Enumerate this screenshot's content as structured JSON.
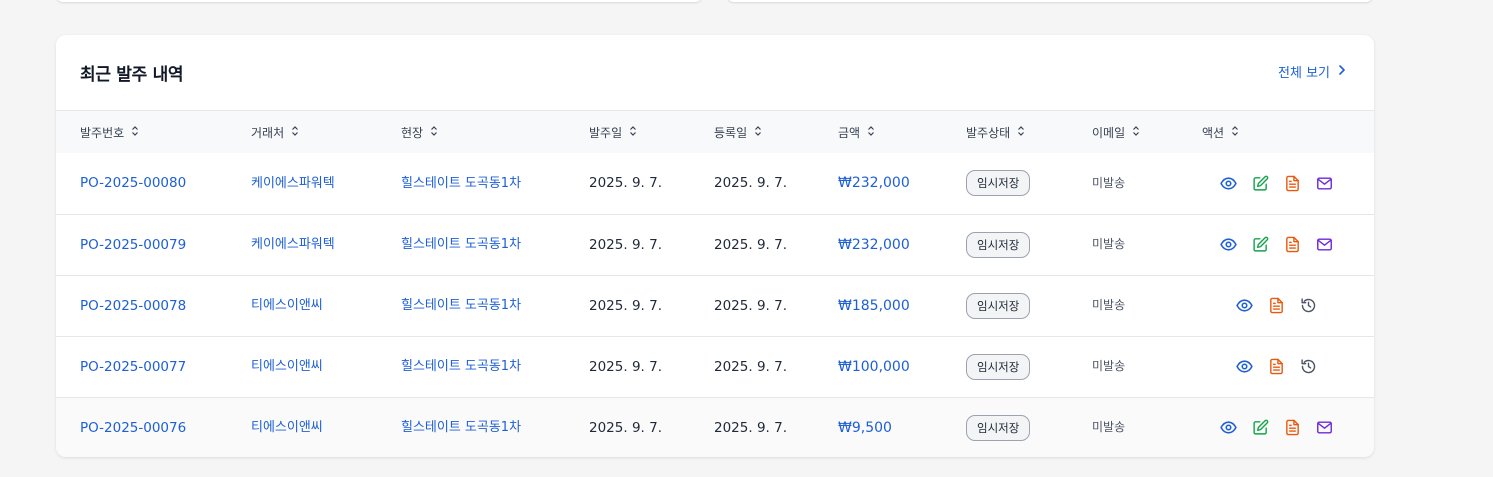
{
  "section": {
    "title": "최근 발주 내역",
    "view_all_label": "전체 보기"
  },
  "table": {
    "headers": [
      "발주번호",
      "거래처",
      "현장",
      "발주일",
      "등록일",
      "금액",
      "발주상태",
      "이메일",
      "액션"
    ],
    "rows": [
      {
        "po_number": "PO-2025-00080",
        "vendor": "케이에스파워텍",
        "site": "힐스테이트 도곡동1차",
        "order_date": "2025. 9. 7.",
        "registered_date": "2025. 9. 7.",
        "amount": "₩232,000",
        "status": "임시저장",
        "email": "미발송",
        "actions": [
          "view-icon",
          "edit-icon",
          "document-icon",
          "mail-icon"
        ]
      },
      {
        "po_number": "PO-2025-00079",
        "vendor": "케이에스파워텍",
        "site": "힐스테이트 도곡동1차",
        "order_date": "2025. 9. 7.",
        "registered_date": "2025. 9. 7.",
        "amount": "₩232,000",
        "status": "임시저장",
        "email": "미발송",
        "actions": [
          "view-icon",
          "edit-icon",
          "document-icon",
          "mail-icon"
        ]
      },
      {
        "po_number": "PO-2025-00078",
        "vendor": "티에스이앤씨",
        "site": "힐스테이트 도곡동1차",
        "order_date": "2025. 9. 7.",
        "registered_date": "2025. 9. 7.",
        "amount": "₩185,000",
        "status": "임시저장",
        "email": "미발송",
        "actions": [
          "view-icon",
          "document-icon",
          "history-icon"
        ]
      },
      {
        "po_number": "PO-2025-00077",
        "vendor": "티에스이앤씨",
        "site": "힐스테이트 도곡동1차",
        "order_date": "2025. 9. 7.",
        "registered_date": "2025. 9. 7.",
        "amount": "₩100,000",
        "status": "임시저장",
        "email": "미발송",
        "actions": [
          "view-icon",
          "document-icon",
          "history-icon"
        ]
      },
      {
        "po_number": "PO-2025-00076",
        "vendor": "티에스이앤씨",
        "site": "힐스테이트 도곡동1차",
        "order_date": "2025. 9. 7.",
        "registered_date": "2025. 9. 7.",
        "amount": "₩9,500",
        "status": "임시저장",
        "email": "미발송",
        "actions": [
          "view-icon",
          "edit-icon",
          "document-icon",
          "mail-icon"
        ]
      }
    ]
  },
  "colors": {
    "link": "#1d5fd6",
    "view_icon": "#1d5fd6",
    "edit_icon": "#16a34a",
    "document_icon": "#ea580c",
    "mail_icon": "#6d28d9",
    "history_icon": "#4b5563"
  }
}
